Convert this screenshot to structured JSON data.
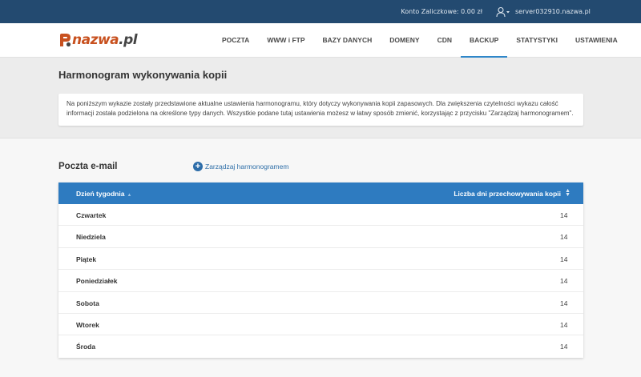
{
  "topbar": {
    "account_label": "Konto Zaliczkowe: 0.00 zł",
    "user_icon": "user-icon",
    "server": "server032910.nazwa.pl"
  },
  "logo": {
    "name": "nazwa",
    "tld": ".pl"
  },
  "nav": {
    "items": [
      {
        "label": "POCZTA",
        "active": false
      },
      {
        "label": "WWW i FTP",
        "active": false
      },
      {
        "label": "BAZY DANYCH",
        "active": false
      },
      {
        "label": "DOMENY",
        "active": false
      },
      {
        "label": "CDN",
        "active": false
      },
      {
        "label": "BACKUP",
        "active": true
      },
      {
        "label": "STATYSTYKI",
        "active": false
      },
      {
        "label": "USTAWIENIA",
        "active": false
      }
    ],
    "active_color": "#2f87c9"
  },
  "page": {
    "title": "Harmonogram wykonywania kopii",
    "info": "Na poniższym wykazie zostały przedstawione aktualne ustawienia harmonogramu, który dotyczy wykonywania kopii zapasowych. Dla zwiększenia czytelności wykazu całość informacji została podzielona na określone typy danych. Wszystkie podane tutaj ustawienia możesz w łatwy sposób zmienić, korzystając z przycisku \"Zarządzaj harmonogramem\"."
  },
  "section": {
    "title": "Poczta e-mail",
    "manage_label": "Zarządzaj harmonogramem"
  },
  "table": {
    "header_color": "#2e7bc0",
    "columns": [
      "Dzień tygodnia",
      "Liczba dni przechowywania kopii"
    ],
    "rows": [
      {
        "day": "Czwartek",
        "count": "14"
      },
      {
        "day": "Niedziela",
        "count": "14"
      },
      {
        "day": "Piątek",
        "count": "14"
      },
      {
        "day": "Poniedziałek",
        "count": "14"
      },
      {
        "day": "Sobota",
        "count": "14"
      },
      {
        "day": "Wtorek",
        "count": "14"
      },
      {
        "day": "Środa",
        "count": "14"
      }
    ]
  }
}
